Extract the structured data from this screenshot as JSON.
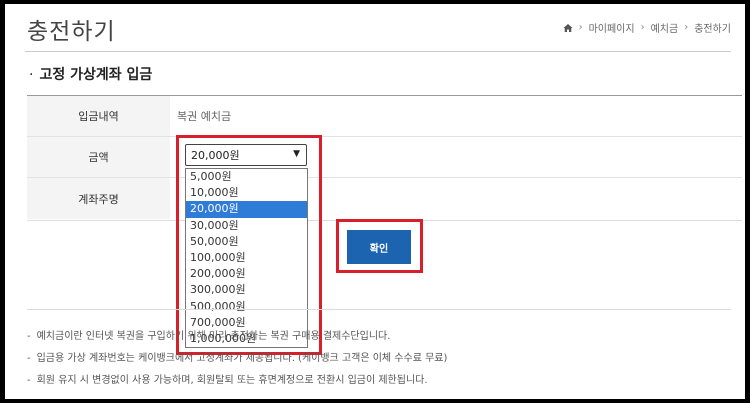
{
  "page_title": "충전하기",
  "breadcrumb": [
    "마이페이지",
    "예치금",
    "충전하기"
  ],
  "section_title": "고정 가상계좌 입금",
  "form": {
    "rows": [
      {
        "label": "입금내역",
        "value": "복권 예치금"
      },
      {
        "label": "금액",
        "value": ""
      },
      {
        "label": "계좌주명",
        "value": ""
      }
    ],
    "amount_select": {
      "selected": "20,000원",
      "options": [
        "5,000원",
        "10,000원",
        "20,000원",
        "30,000원",
        "50,000원",
        "100,000원",
        "200,000원",
        "300,000원",
        "500,000원",
        "700,000원",
        "1,000,000원"
      ],
      "highlighted_index": 2
    }
  },
  "confirm_label": "확인",
  "notes": [
    "예치금이란 인터넷 복권을 구입하기 위해 미리 충전하는 복권 구매용 결제수단입니다.",
    "입금용 가상 계좌번호는 케이뱅크에서 고정계좌가 제공됩니다. (케이뱅크 고객은 이체 수수료 무료)",
    "회원 유지 시 변경없이 사용 가능하며, 회원탈퇴 또는 휴면계정으로 전환시 입금이 제한됩니다."
  ],
  "colors": {
    "highlight": "#d91f2a",
    "button": "#1c63b0",
    "selected_option": "#2f7bd8"
  }
}
